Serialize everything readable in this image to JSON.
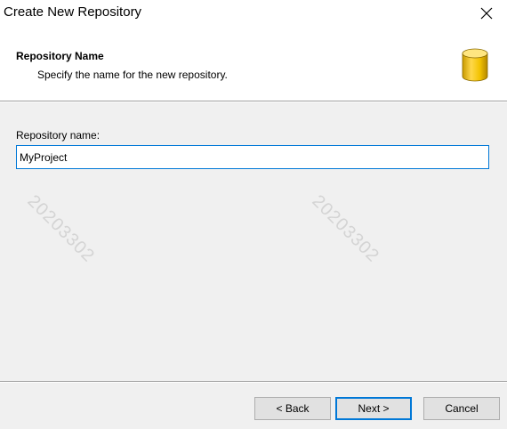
{
  "window": {
    "title": "Create New Repository"
  },
  "header": {
    "title": "Repository Name",
    "subtitle": "Specify the name for the new repository."
  },
  "form": {
    "repo_label": "Repository name:",
    "repo_value": "MyProject"
  },
  "watermark": {
    "text": "20203302"
  },
  "buttons": {
    "back": "< Back",
    "next": "Next >",
    "cancel": "Cancel"
  },
  "colors": {
    "accent": "#0078d7",
    "db_icon": "#f2c200"
  }
}
